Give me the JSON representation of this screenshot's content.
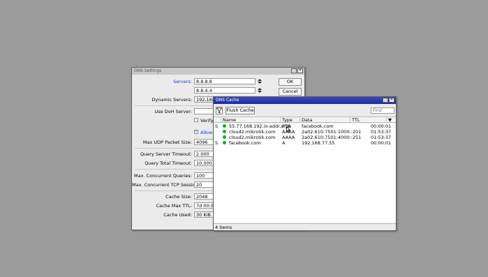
{
  "dns_settings": {
    "title": "DNS Settings",
    "servers_label": "Servers:",
    "servers": [
      "8.8.8.8",
      "8.8.4.4"
    ],
    "dynamic_servers_label": "Dynamic Servers:",
    "dynamic_servers_value": "192.168.",
    "use_doh_label": "Use DoH Server:",
    "verify_label": "Verify",
    "allow_label": "Allow R",
    "max_udp_label": "Max UDP Packet Size:",
    "max_udp_value": "4096",
    "query_server_timeout_label": "Query Server Timeout:",
    "query_server_timeout_value": "2.000",
    "query_total_timeout_label": "Query Total Timeout:",
    "query_total_timeout_value": "10.000",
    "max_concurrent_queries_label": "Max. Concurrent Queries:",
    "max_concurrent_queries_value": "100",
    "max_concurrent_tcp_label": "Max. Concurrent TCP Sessions:",
    "max_concurrent_tcp_value": "20",
    "cache_size_label": "Cache Size:",
    "cache_size_value": "2048",
    "cache_max_ttl_label": "Cache Max TTL:",
    "cache_max_ttl_value": "7d 00:00",
    "cache_used_label": "Cache Used:",
    "cache_used_value": "30 KiB",
    "ok_label": "OK",
    "cancel_label": "Cancel"
  },
  "dns_cache": {
    "title": "DNS Cache",
    "flush_label": "Flush Cache",
    "find_placeholder": "Find",
    "columns": [
      "Name",
      "Type",
      "Data",
      "TTL"
    ],
    "rows": [
      {
        "flag": "S",
        "name": "55.77.168.192.in-addr.arpa",
        "type": "PTR",
        "data": "facebook.com",
        "ttl": "00:00:01"
      },
      {
        "flag": "",
        "name": "cloud2.mikrotik.com",
        "type": "AAAA",
        "data": "2a02:610:7501:1000::201",
        "ttl": "01:53:37"
      },
      {
        "flag": "",
        "name": "cloud2.mikrotik.com",
        "type": "AAAA",
        "data": "2a02:610:7501:4000::251",
        "ttl": "01:53:37"
      },
      {
        "flag": "S",
        "name": "facebook.com",
        "type": "A",
        "data": "192.168.77.55",
        "ttl": "00:00:01"
      }
    ],
    "status_text": "4 items"
  }
}
